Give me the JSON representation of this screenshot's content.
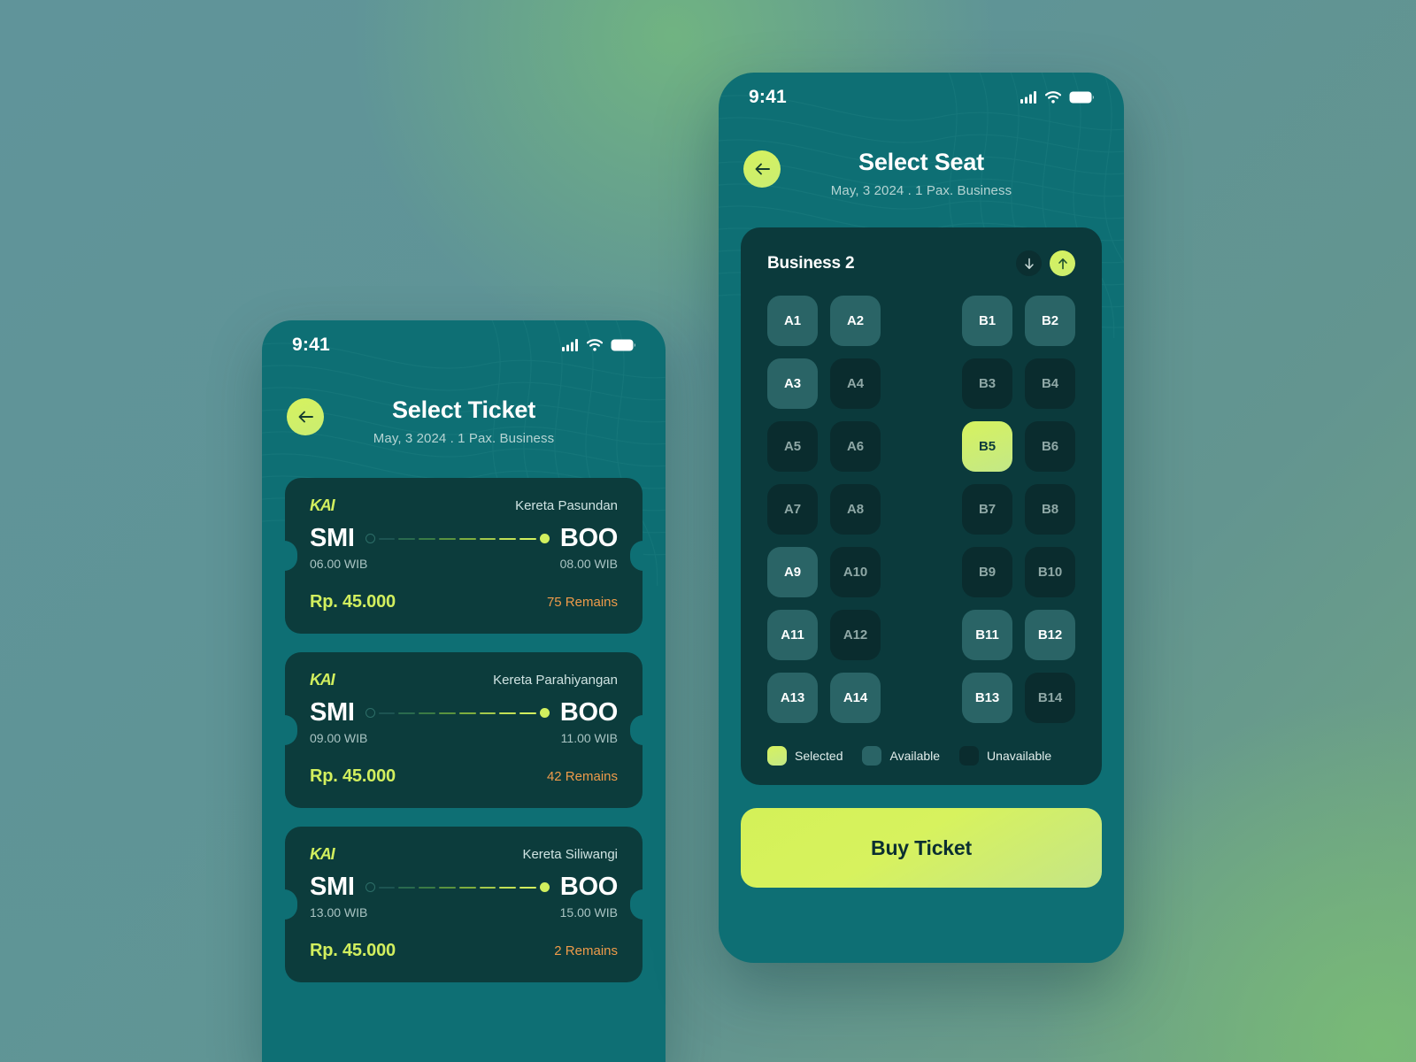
{
  "theme": {
    "accent": "#d2ef5e",
    "phone_bg": "#0e6f74",
    "card_bg": "#0c3c3c",
    "panel_bg": "#0b3a3c",
    "seat_available": "#2a6466",
    "seat_unavailable": "#0a2c2e",
    "warning": "#ee9b4a"
  },
  "phone1": {
    "status": {
      "time": "9:41",
      "signal": "signal-icon",
      "wifi": "wifi-icon",
      "battery": "battery-icon"
    },
    "header": {
      "back": "back-arrow-icon",
      "title": "Select Ticket",
      "subtitle": "May, 3 2024 . 1 Pax. Business"
    },
    "tickets": [
      {
        "brand": "KAI",
        "train": "Kereta Pasundan",
        "from": "SMI",
        "to": "BOO",
        "depart": "06.00 WIB",
        "arrive": "08.00 WIB",
        "price": "Rp. 45.000",
        "remains": "75 Remains"
      },
      {
        "brand": "KAI",
        "train": "Kereta Parahiyangan",
        "from": "SMI",
        "to": "BOO",
        "depart": "09.00 WIB",
        "arrive": "11.00 WIB",
        "price": "Rp. 45.000",
        "remains": "42 Remains"
      },
      {
        "brand": "KAI",
        "train": "Kereta Siliwangi",
        "from": "SMI",
        "to": "BOO",
        "depart": "13.00 WIB",
        "arrive": "15.00 WIB",
        "price": "Rp. 45.000",
        "remains": "2 Remains"
      }
    ]
  },
  "phone2": {
    "status": {
      "time": "9:41",
      "signal": "signal-icon",
      "wifi": "wifi-icon",
      "battery": "battery-icon"
    },
    "header": {
      "back": "back-arrow-icon",
      "title": "Select Seat",
      "subtitle": "May, 3 2024 . 1 Pax. Business"
    },
    "seat_panel": {
      "coach": "Business 2",
      "nav_down": "arrow-down-icon",
      "nav_up": "arrow-up-icon",
      "rows": [
        [
          {
            "label": "A1",
            "state": "available"
          },
          {
            "label": "A2",
            "state": "available"
          },
          {
            "label": "B1",
            "state": "available"
          },
          {
            "label": "B2",
            "state": "available"
          }
        ],
        [
          {
            "label": "A3",
            "state": "available"
          },
          {
            "label": "A4",
            "state": "unavailable"
          },
          {
            "label": "B3",
            "state": "unavailable"
          },
          {
            "label": "B4",
            "state": "unavailable"
          }
        ],
        [
          {
            "label": "A5",
            "state": "unavailable"
          },
          {
            "label": "A6",
            "state": "unavailable"
          },
          {
            "label": "B5",
            "state": "selected"
          },
          {
            "label": "B6",
            "state": "unavailable"
          }
        ],
        [
          {
            "label": "A7",
            "state": "unavailable"
          },
          {
            "label": "A8",
            "state": "unavailable"
          },
          {
            "label": "B7",
            "state": "unavailable"
          },
          {
            "label": "B8",
            "state": "unavailable"
          }
        ],
        [
          {
            "label": "A9",
            "state": "available"
          },
          {
            "label": "A10",
            "state": "unavailable"
          },
          {
            "label": "B9",
            "state": "unavailable"
          },
          {
            "label": "B10",
            "state": "unavailable"
          }
        ],
        [
          {
            "label": "A11",
            "state": "available"
          },
          {
            "label": "A12",
            "state": "unavailable"
          },
          {
            "label": "B11",
            "state": "available"
          },
          {
            "label": "B12",
            "state": "available"
          }
        ],
        [
          {
            "label": "A13",
            "state": "available"
          },
          {
            "label": "A14",
            "state": "available"
          },
          {
            "label": "B13",
            "state": "available"
          },
          {
            "label": "B14",
            "state": "unavailable"
          }
        ]
      ],
      "legend": [
        {
          "state": "selected",
          "label": "Selected"
        },
        {
          "state": "available",
          "label": "Available"
        },
        {
          "state": "unavailable",
          "label": "Unavailable"
        }
      ]
    },
    "buy_button": "Buy Ticket"
  }
}
